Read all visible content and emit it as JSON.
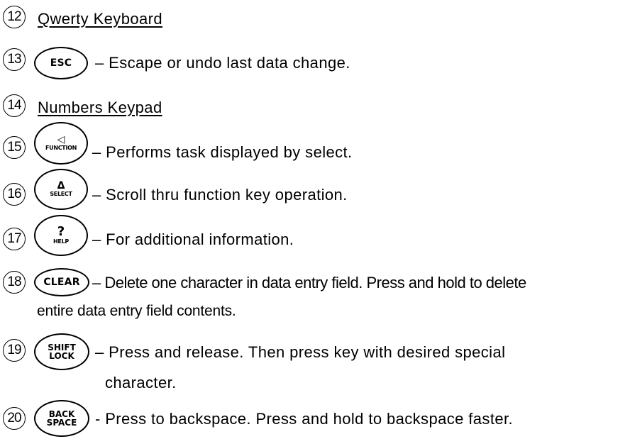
{
  "items": [
    {
      "number": "12",
      "text": "Qwerty Keyboard"
    },
    {
      "number": "13",
      "key": {
        "label": "ESC"
      },
      "text": "– Escape or undo last data change."
    },
    {
      "number": "14",
      "text": "Numbers Keypad"
    },
    {
      "number": "15",
      "key": {
        "symbol": "◁",
        "label": "FUNCTION"
      },
      "text": "– Performs task displayed by select."
    },
    {
      "number": "16",
      "key": {
        "symbol": "Δ",
        "label": "SELECT"
      },
      "text": "– Scroll thru function key operation."
    },
    {
      "number": "17",
      "key": {
        "symbol": "?",
        "label": "HELP"
      },
      "text": "– For additional information."
    },
    {
      "number": "18",
      "key": {
        "label": "CLEAR"
      },
      "text": "– Delete one character in data entry field.  Press and hold to delete",
      "text_cont": "entire data entry field contents."
    },
    {
      "number": "19",
      "key": {
        "line1": "SHIFT",
        "line2": "LOCK"
      },
      "text": "– Press and release. Then press key with desired special",
      "text_cont": "character."
    },
    {
      "number": "20",
      "key": {
        "line1": "BACK",
        "line2": "SPACE"
      },
      "text": "-  Press to backspace. Press and hold to backspace faster."
    }
  ]
}
